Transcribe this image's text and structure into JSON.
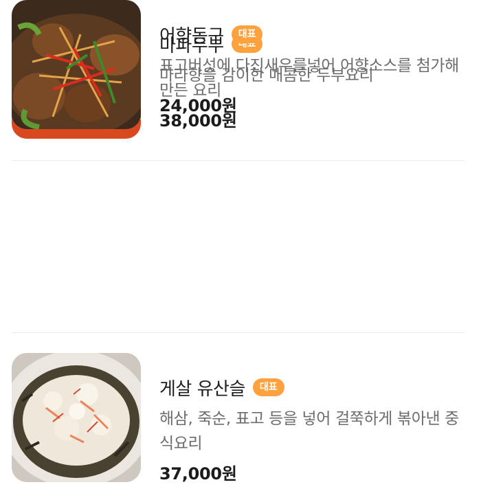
{
  "menu": {
    "items": [
      {
        "name": "마파두부",
        "badge": "대표",
        "description": "마라향을 감이한 매콤한 두부요리",
        "price": "24,000원",
        "image": "mapo-tofu-photo"
      },
      {
        "name": "게살 유산슬",
        "badge": "대표",
        "description": "해삼, 죽순, 표고 등을 넣어 걸쭉하게 볶아낸 중식요리",
        "price": "37,000원",
        "image": "crab-yusanseul-photo"
      },
      {
        "name": "어향동구",
        "badge": "대표",
        "description": "표고버섯에 다진새우를넣어 어향소스를 첨가해 만든 요리",
        "price": "38,000원",
        "image": "eohyang-donggu-photo"
      }
    ]
  },
  "colors": {
    "badge_bg": "#ffa13c",
    "badge_text": "#ffffff",
    "description_text": "#6c6c6c",
    "price_text": "#1b1b1b"
  }
}
